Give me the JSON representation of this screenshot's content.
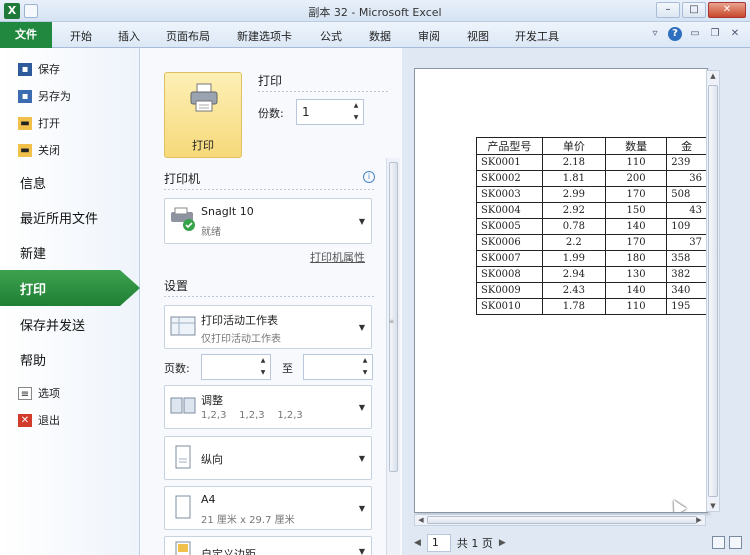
{
  "window": {
    "title": "副本 32 - Microsoft Excel",
    "app_icon": "X"
  },
  "ribbon": {
    "file_tab": "文件",
    "tabs": [
      "开始",
      "插入",
      "页面布局",
      "新建选项卡",
      "公式",
      "数据",
      "审阅",
      "视图",
      "开发工具"
    ]
  },
  "backstage": {
    "small_items": [
      "保存",
      "另存为",
      "打开",
      "关闭"
    ],
    "big_items": [
      "信息",
      "最近所用文件",
      "新建"
    ],
    "selected": "打印",
    "lower_items": [
      "保存并发送",
      "帮助"
    ],
    "bottom_items": [
      "选项",
      "退出"
    ]
  },
  "print": {
    "button_label": "打印",
    "section_title": "打印",
    "copies_label": "份数:",
    "copies_value": "1",
    "printer_title": "打印机",
    "printer_name": "SnagIt 10",
    "printer_status": "就绪",
    "printer_props_link": "打印机属性",
    "settings_title": "设置",
    "settings": [
      {
        "title": "打印活动工作表",
        "subtitle": "仅打印活动工作表",
        "icon": "sheet-icon"
      },
      {
        "title": "调整",
        "subtitle": "1,2,3    1,2,3    1,2,3",
        "icon": "collate-icon"
      },
      {
        "title": "纵向",
        "subtitle": "",
        "icon": "portrait-icon"
      },
      {
        "title": "A4",
        "subtitle": "21 厘米 x 29.7 厘米",
        "icon": "paper-icon"
      },
      {
        "title": "自定义边距",
        "subtitle": "",
        "icon": "margins-icon"
      }
    ],
    "pages_label": "页数:",
    "to_label": "至"
  },
  "preview": {
    "headers": [
      "产品型号",
      "单价",
      "数量",
      "金"
    ],
    "rows": [
      [
        "SK0001",
        "2.18",
        "110",
        "239"
      ],
      [
        "SK0002",
        "1.81",
        "200",
        "36"
      ],
      [
        "SK0003",
        "2.99",
        "170",
        "508"
      ],
      [
        "SK0004",
        "2.92",
        "150",
        "43"
      ],
      [
        "SK0005",
        "0.78",
        "140",
        "109"
      ],
      [
        "SK0006",
        "2.2",
        "170",
        "37"
      ],
      [
        "SK0007",
        "1.99",
        "180",
        "358"
      ],
      [
        "SK0008",
        "2.94",
        "130",
        "382"
      ],
      [
        "SK0009",
        "2.43",
        "140",
        "340"
      ],
      [
        "SK0010",
        "1.78",
        "110",
        "195"
      ]
    ],
    "page_current": "1",
    "page_total": "共 1 页"
  },
  "colors": {
    "file_green": "#21893f",
    "selected_green": "#2e9343",
    "print_button": "#f6d97a"
  }
}
